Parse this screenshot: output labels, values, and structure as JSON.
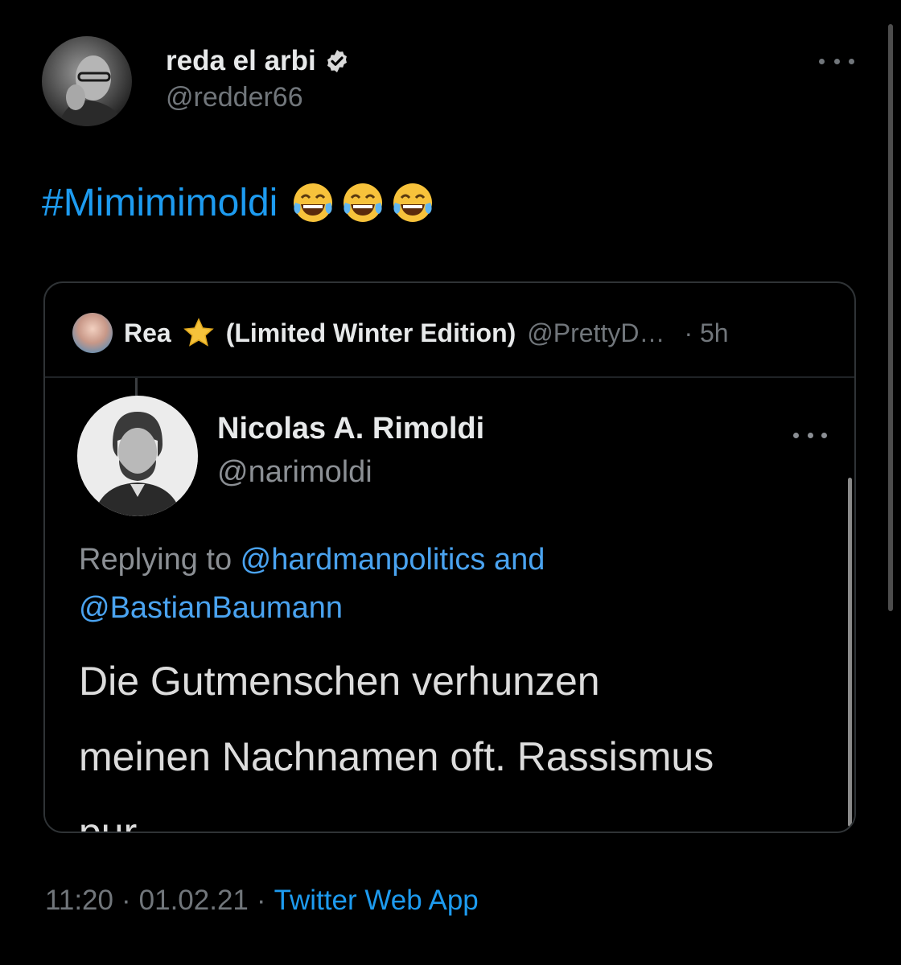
{
  "author": {
    "display_name": "reda el arbi",
    "handle": "@redder66",
    "verified": true
  },
  "tweet": {
    "hashtag": "#Mimimimoldi",
    "emojis": [
      "face-with-tears-of-joy",
      "face-with-tears-of-joy",
      "face-with-tears-of-joy"
    ]
  },
  "quote": {
    "name": "Rea",
    "star_emoji": "star",
    "edition": "(Limited Winter Edition)",
    "handle": "@PrettyD…",
    "time": "· 5h",
    "embedded": {
      "name": "Nicolas A. Rimoldi",
      "handle": "@narimoldi",
      "replying_prefix": "Replying to ",
      "mention_1": "@hardmanpolitics",
      "and": " and",
      "mention_2": "@BastianBaumann",
      "body_line_1": "Die Gutmenschen verhunzen",
      "body_line_2": "meinen Nachnamen oft. Rassismus",
      "body_line_3": "pur."
    }
  },
  "meta": {
    "time": "11:20",
    "sep1": "·",
    "date": "01.02.21",
    "sep2": "·",
    "source": "Twitter Web App"
  },
  "colors": {
    "background": "#000000",
    "accent_blue": "#1d9bf0",
    "muted": "#71767b",
    "text": "#e7e9ea"
  }
}
